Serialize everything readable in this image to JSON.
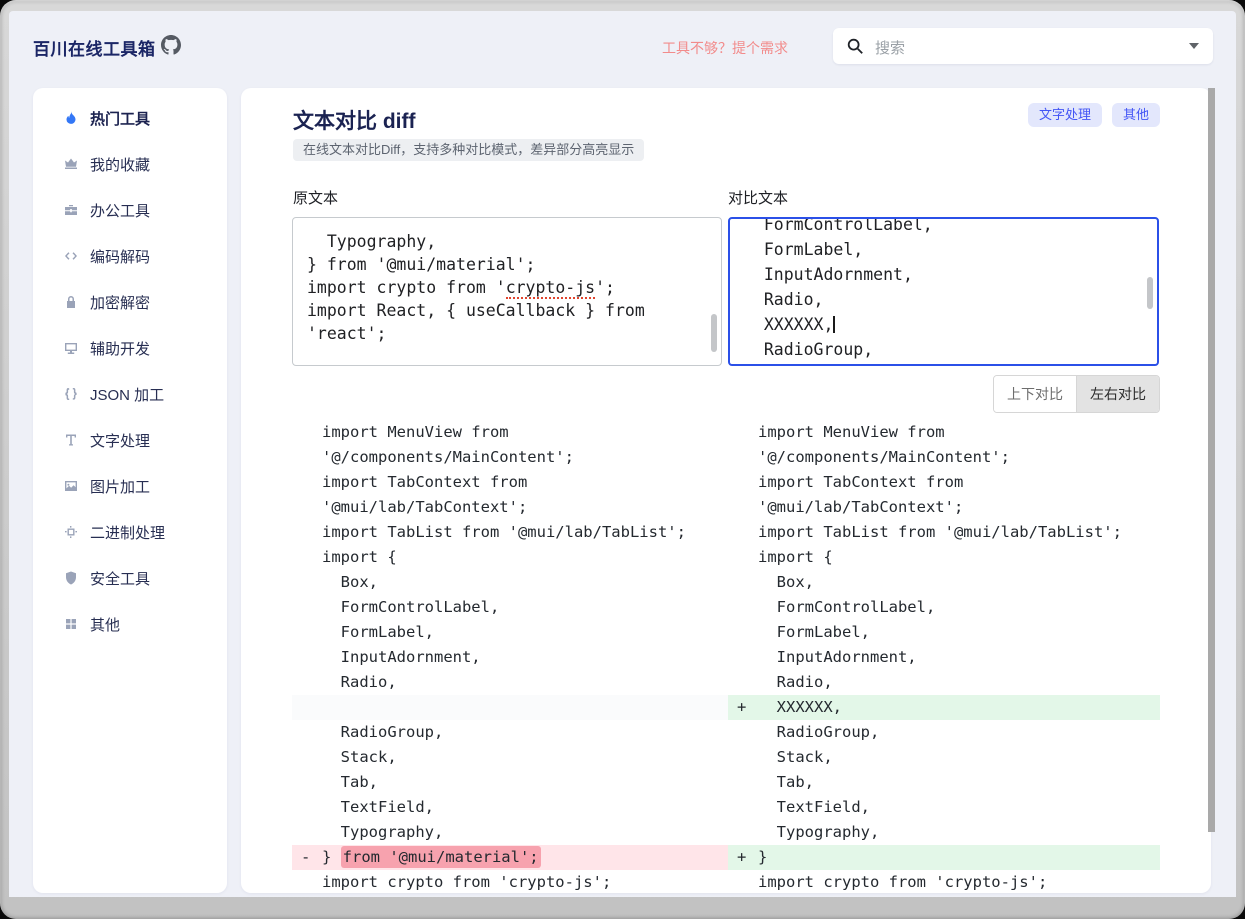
{
  "header": {
    "brand": "百川在线工具箱",
    "need_link": "工具不够？提个需求",
    "search_placeholder": "搜索"
  },
  "sidebar": {
    "items": [
      {
        "label": "热门工具",
        "icon": "flame-icon",
        "active": true
      },
      {
        "label": "我的收藏",
        "icon": "crown-icon",
        "active": false
      },
      {
        "label": "办公工具",
        "icon": "briefcase-icon",
        "active": false
      },
      {
        "label": "编码解码",
        "icon": "code-icon",
        "active": false
      },
      {
        "label": "加密解密",
        "icon": "lock-icon",
        "active": false
      },
      {
        "label": "辅助开发",
        "icon": "monitor-icon",
        "active": false
      },
      {
        "label": "JSON 加工",
        "icon": "braces-icon",
        "active": false
      },
      {
        "label": "文字处理",
        "icon": "text-icon",
        "active": false
      },
      {
        "label": "图片加工",
        "icon": "image-icon",
        "active": false
      },
      {
        "label": "二进制处理",
        "icon": "chip-icon",
        "active": false
      },
      {
        "label": "安全工具",
        "icon": "shield-icon",
        "active": false
      },
      {
        "label": "其他",
        "icon": "blocks-icon",
        "active": false
      }
    ]
  },
  "tool": {
    "title": "文本对比 diff",
    "description": "在线文本对比Diff，支持多种对比模式，差异部分高亮显示",
    "tags": [
      "文字处理",
      "其他"
    ],
    "original_label": "原文本",
    "compare_label": "对比文本",
    "mode_buttons": [
      {
        "label": "上下对比",
        "active": false
      },
      {
        "label": "左右对比",
        "active": true
      }
    ]
  },
  "original_textarea": {
    "lines": [
      {
        "text": "  Typography,"
      },
      {
        "text": "} from '@mui/material';"
      },
      {
        "text": "import crypto from 'crypto-js';",
        "spell": "crypto-js"
      },
      {
        "text": "import React, { useCallback } from"
      },
      {
        "text": "'react';"
      }
    ]
  },
  "compare_textarea": {
    "lines": [
      {
        "text": "  FormControlLabel,"
      },
      {
        "text": "  FormLabel,"
      },
      {
        "text": "  InputAdornment,"
      },
      {
        "text": "  Radio,"
      },
      {
        "text": "  XXXXXX,",
        "cursor": true
      },
      {
        "text": "  RadioGroup,"
      }
    ]
  },
  "diff": {
    "colors": {
      "added_bg": "#e3f7e8",
      "removed_bg": "#ffe5e9",
      "removed_mark": "#f7a2ae",
      "empty_bg": "#fafbfc"
    },
    "left_rows": [
      {
        "type": "ctx",
        "text": "import MenuView from"
      },
      {
        "type": "ctx",
        "text": "'@/components/MainContent';"
      },
      {
        "type": "ctx",
        "text": "import TabContext from"
      },
      {
        "type": "ctx",
        "text": "'@mui/lab/TabContext';"
      },
      {
        "type": "ctx",
        "text": "import TabList from '@mui/lab/TabList';"
      },
      {
        "type": "ctx",
        "text": "import {"
      },
      {
        "type": "ctx",
        "text": "  Box,"
      },
      {
        "type": "ctx",
        "text": "  FormControlLabel,"
      },
      {
        "type": "ctx",
        "text": "  FormLabel,"
      },
      {
        "type": "ctx",
        "text": "  InputAdornment,"
      },
      {
        "type": "ctx",
        "text": "  Radio,"
      },
      {
        "type": "empty",
        "text": ""
      },
      {
        "type": "ctx",
        "text": "  RadioGroup,"
      },
      {
        "type": "ctx",
        "text": "  Stack,"
      },
      {
        "type": "ctx",
        "text": "  Tab,"
      },
      {
        "type": "ctx",
        "text": "  TextField,"
      },
      {
        "type": "ctx",
        "text": "  Typography,"
      },
      {
        "type": "del",
        "marker": "-",
        "text": "} ",
        "mark": "from '@mui/material';"
      },
      {
        "type": "ctx",
        "text": "import crypto from 'crypto-js';"
      }
    ],
    "right_rows": [
      {
        "type": "ctx",
        "text": "import MenuView from"
      },
      {
        "type": "ctx",
        "text": "'@/components/MainContent';"
      },
      {
        "type": "ctx",
        "text": "import TabContext from"
      },
      {
        "type": "ctx",
        "text": "'@mui/lab/TabContext';"
      },
      {
        "type": "ctx",
        "text": "import TabList from '@mui/lab/TabList';"
      },
      {
        "type": "ctx",
        "text": "import {"
      },
      {
        "type": "ctx",
        "text": "  Box,"
      },
      {
        "type": "ctx",
        "text": "  FormControlLabel,"
      },
      {
        "type": "ctx",
        "text": "  FormLabel,"
      },
      {
        "type": "ctx",
        "text": "  InputAdornment,"
      },
      {
        "type": "ctx",
        "text": "  Radio,"
      },
      {
        "type": "add",
        "marker": "+",
        "text": "  XXXXXX,"
      },
      {
        "type": "ctx",
        "text": "  RadioGroup,"
      },
      {
        "type": "ctx",
        "text": "  Stack,"
      },
      {
        "type": "ctx",
        "text": "  Tab,"
      },
      {
        "type": "ctx",
        "text": "  TextField,"
      },
      {
        "type": "ctx",
        "text": "  Typography,"
      },
      {
        "type": "add",
        "marker": "+",
        "text": "}"
      },
      {
        "type": "ctx",
        "text": "import crypto from 'crypto-js';"
      }
    ]
  }
}
